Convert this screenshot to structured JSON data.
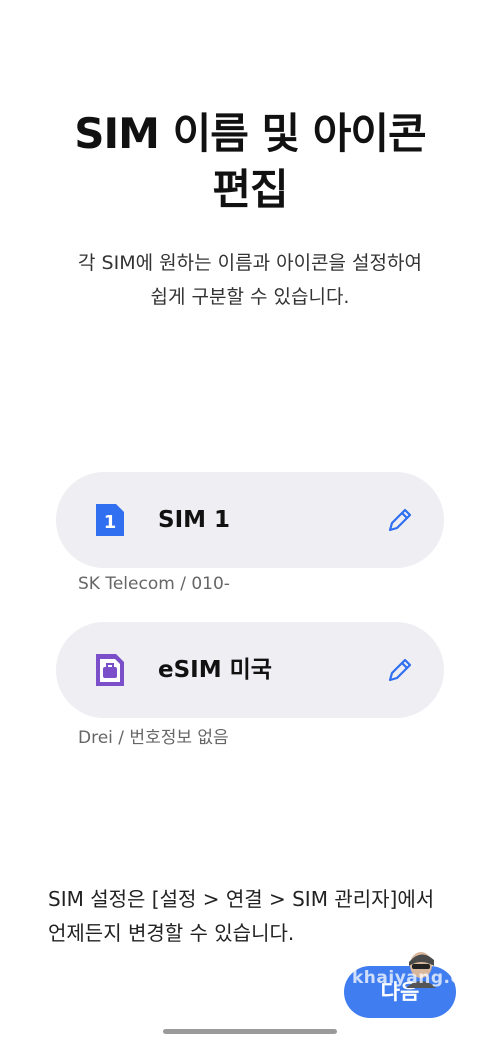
{
  "title": "SIM 이름 및 아이콘\n편집",
  "subtitle": "각 SIM에 원하는 이름과 아이콘을 설정하여\n쉽게 구분할 수 있습니다.",
  "sims": [
    {
      "icon": "sim-1-icon",
      "icon_label": "1",
      "icon_color": "#2f6ff0",
      "name": "SIM 1",
      "carrier": "SK Telecom / 010-"
    },
    {
      "icon": "briefcase-icon",
      "icon_color": "#7b4fc9",
      "name": "eSIM 미국",
      "carrier": "Drei / 번호정보 없음"
    }
  ],
  "edit_icon": "pencil-icon",
  "footnote": "SIM 설정은 [설정 > 연결 > SIM 관리자]에서\n언제든지 변경할 수 있습니다.",
  "next_label": "다음",
  "watermark": "khaiyang.com",
  "colors": {
    "accent": "#3f7df0",
    "card_bg": "#eeeef3"
  }
}
